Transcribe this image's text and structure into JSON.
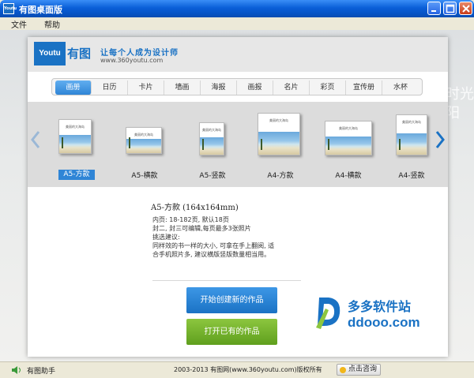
{
  "window": {
    "title": "有图桌面版",
    "app_icon_text": "Youtu"
  },
  "menu": {
    "file": "文件",
    "help": "帮助"
  },
  "header": {
    "logo_text": "Youtu",
    "logo_cn": "有图",
    "slogan": "让每个人成为设计师",
    "url": "www.360youtu.com"
  },
  "background_text": "时光\n阳",
  "tabs": [
    {
      "label": "画册"
    },
    {
      "label": "日历"
    },
    {
      "label": "卡片"
    },
    {
      "label": "墙画"
    },
    {
      "label": "海报"
    },
    {
      "label": "画报"
    },
    {
      "label": "名片"
    },
    {
      "label": "彩页"
    },
    {
      "label": "宣传册"
    },
    {
      "label": "水杯"
    }
  ],
  "active_tab": "画册",
  "album_cover_caption": "美丽的大海岛",
  "products": [
    {
      "label": "A5-方款"
    },
    {
      "label": "A5-横款"
    },
    {
      "label": "A5-竖款"
    },
    {
      "label": "A4-方款"
    },
    {
      "label": "A4-横款"
    },
    {
      "label": "A4-竖款"
    }
  ],
  "selected_product": "A5-方款",
  "detail": {
    "title": "A5-方款 (164x164mm)",
    "lines": [
      "内页: 18-182页, 默认18页",
      "封二, 封三可编辑,每页最多3张照片",
      "挑选建议:",
      "同样效的书一样的大小, 可拿在手上翻阅, 适",
      "合手机照片多, 建议横版竖版数量相当用。"
    ]
  },
  "buttons": {
    "create": "开始创建新的作品",
    "open": "打开已有的作品"
  },
  "watermark": {
    "cn": "多多软件站",
    "en": "ddooo.com"
  },
  "status": {
    "helper": "有图助手",
    "copyright": "2003-2013 有图网(www.360youtu.com)版权所有",
    "consult": "点击咨询"
  },
  "colors": {
    "accent": "#1a72c4",
    "green": "#6aa82b",
    "titlebar": "#0a5fd8"
  }
}
